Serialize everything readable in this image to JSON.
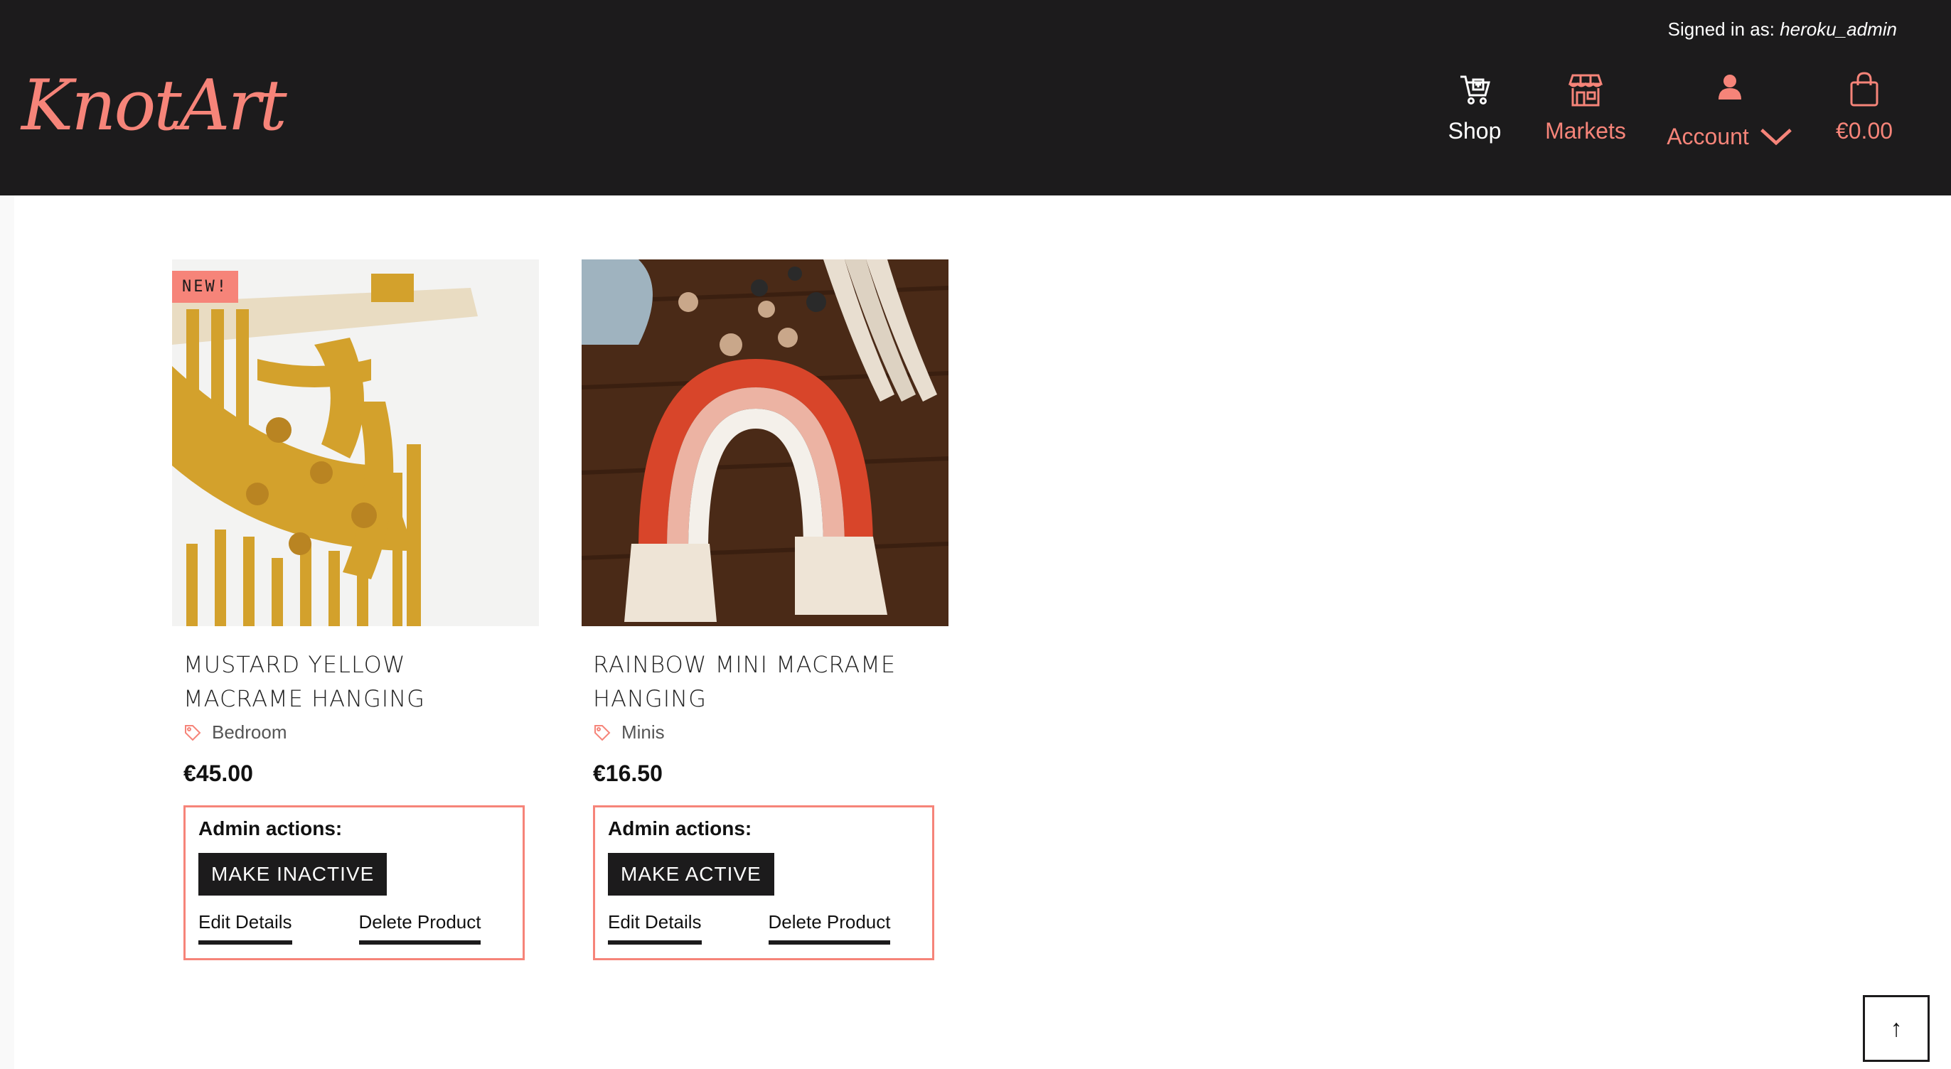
{
  "header": {
    "signed_in_prefix": "Signed in as:",
    "signed_in_user": "heroku_admin",
    "logo": "KnotArt",
    "nav": {
      "shop": "Shop",
      "markets": "Markets",
      "account": "Account",
      "bag_total": "€0.00"
    }
  },
  "products": [
    {
      "badge": "NEW!",
      "title": "MUSTARD YELLOW MACRAME HANGING",
      "category": "Bedroom",
      "price": "€45.00",
      "admin_label": "Admin actions:",
      "toggle_label": "MAKE INACTIVE",
      "edit_label": "Edit Details",
      "delete_label": "Delete Product"
    },
    {
      "title": "RAINBOW MINI MACRAME HANGING",
      "category": "Minis",
      "price": "€16.50",
      "admin_label": "Admin actions:",
      "toggle_label": "MAKE ACTIVE",
      "edit_label": "Edit Details",
      "delete_label": "Delete Product"
    }
  ],
  "scroll_top": "↑",
  "colors": {
    "header_bg": "#1c1b1c",
    "accent": "#f68479",
    "white": "#ffffff"
  }
}
